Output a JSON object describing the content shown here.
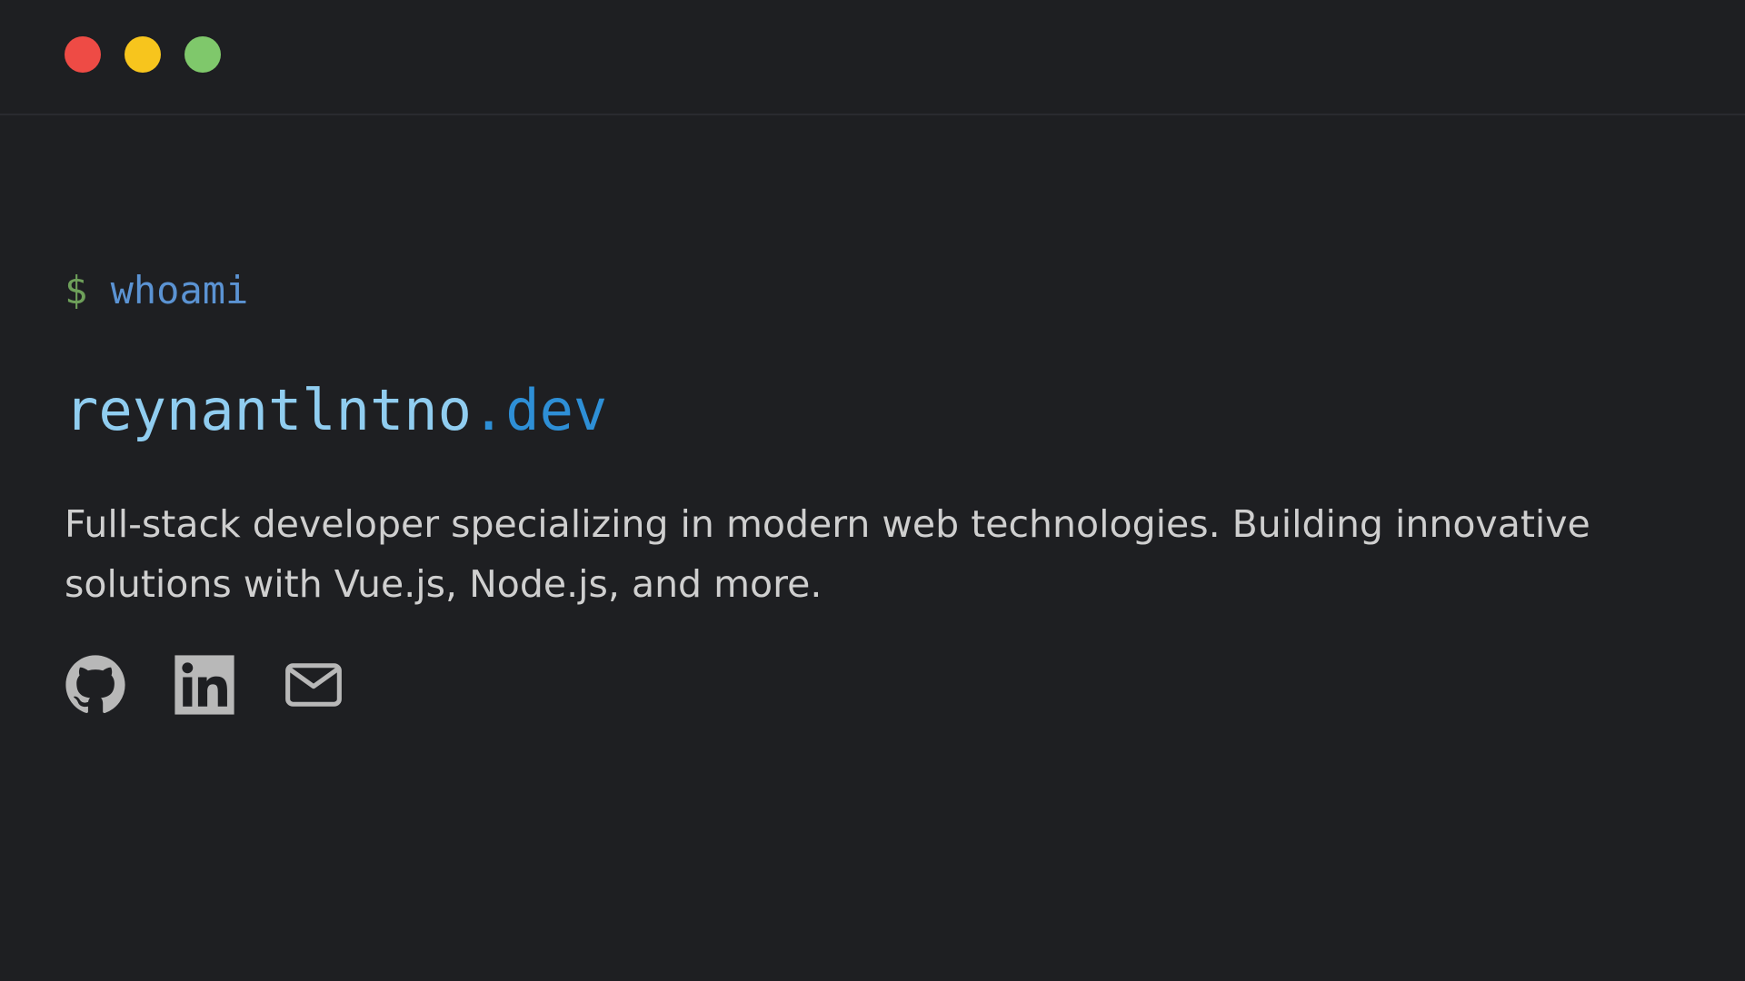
{
  "window": {
    "controls": [
      {
        "name": "close",
        "color": "#ee4b45"
      },
      {
        "name": "minimize",
        "color": "#f7c51d"
      },
      {
        "name": "maximize",
        "color": "#7fc86b"
      }
    ]
  },
  "terminal": {
    "prompt_symbol": "$",
    "command": "whoami"
  },
  "hero": {
    "name": "reynantlntno",
    "tld": ".dev",
    "bio": "Full-stack developer specializing in modern web technologies. Building innovative solutions with Vue.js, Node.js, and more."
  },
  "social": [
    {
      "icon": "github-icon"
    },
    {
      "icon": "linkedin-icon"
    },
    {
      "icon": "mail-icon"
    }
  ],
  "colors": {
    "background": "#1e1f22",
    "prompt": "#6ea05a",
    "command": "#5b93d3",
    "name": "#90cdf0",
    "tld": "#2e8fd6",
    "text": "#cfcfcf",
    "icon": "#b8b8b8"
  }
}
